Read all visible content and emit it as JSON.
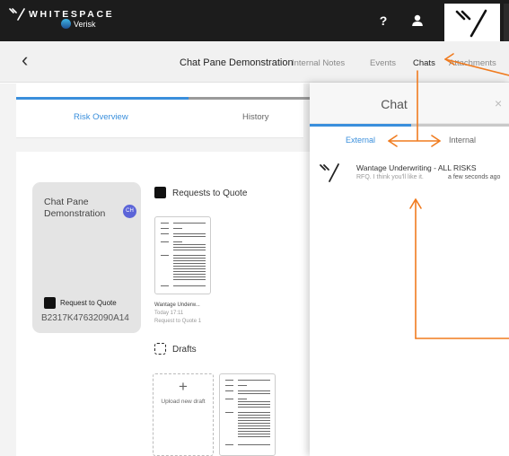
{
  "app": {
    "brand": "WHITESPACE",
    "sub_brand": "Verisk",
    "help_label": "?"
  },
  "nav": {
    "back_label": "‹",
    "title": "Chat Pane Demonstration",
    "links": [
      {
        "label": "Internal Notes"
      },
      {
        "label": "Events"
      },
      {
        "label": "Chats"
      },
      {
        "label": "Attachments"
      }
    ]
  },
  "tabs": {
    "risk_overview": "Risk Overview",
    "history": "History"
  },
  "card": {
    "title": "Chat Pane Demonstration",
    "avatar": "CH",
    "doc_label": "Request to Quote",
    "reference": "B2317K47632090A14"
  },
  "sections": {
    "requests_title": "Requests to Quote",
    "drafts_title": "Drafts",
    "upload_label": "Upload new draft"
  },
  "quote_document": {
    "name": "Wantage Underw...",
    "time": "Today 17:11",
    "type": "Request to Quote 1"
  },
  "chat": {
    "title": "Chat",
    "close_label": "×",
    "tabs": {
      "external": "External",
      "internal": "Internal"
    },
    "items": [
      {
        "title": "Wantage Underwriting - ALL RISKS",
        "message": "RFQ. I think you'll like it.",
        "time": "a few seconds ago"
      }
    ]
  },
  "colors": {
    "accent_blue": "#3a8fdc",
    "annotation_orange": "#f07b1f",
    "topbar_dark": "#1c1c1c"
  }
}
